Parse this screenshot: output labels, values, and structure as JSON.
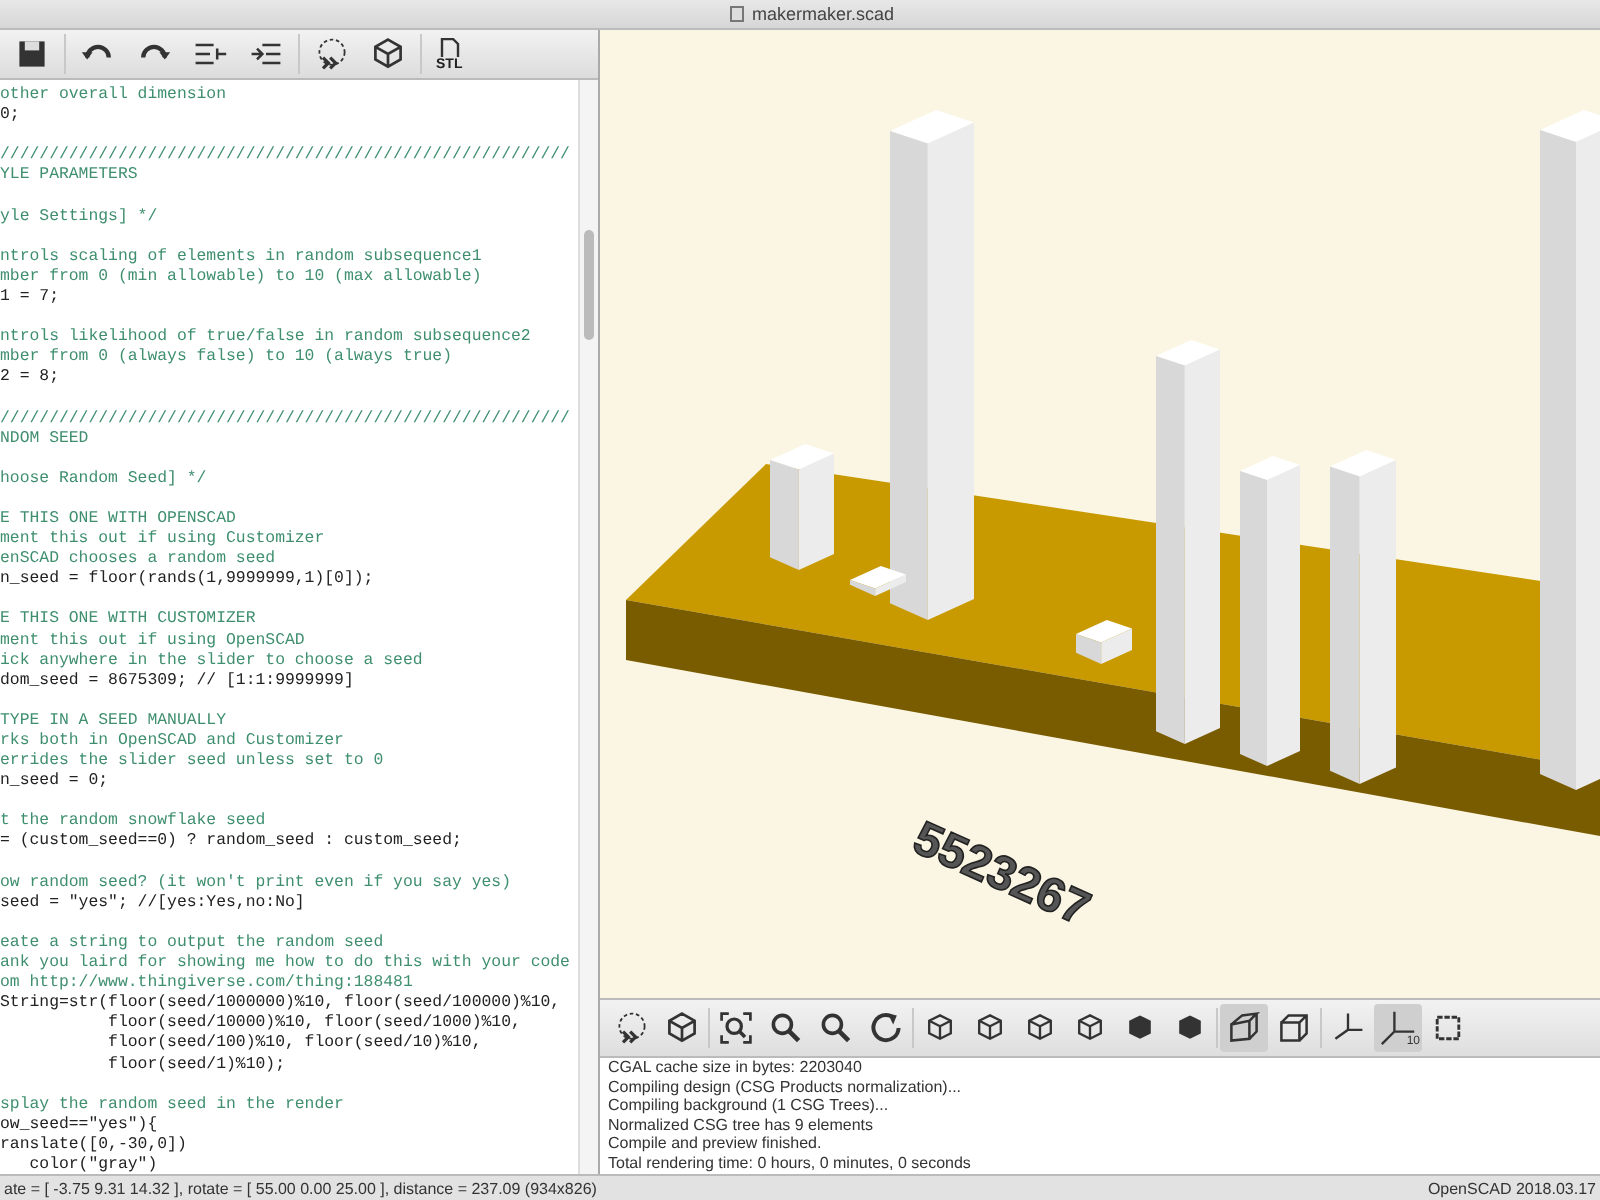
{
  "window": {
    "title": "makermaker.scad"
  },
  "editor_toolbar": [
    {
      "kind": "save"
    },
    {
      "kind": "undo"
    },
    {
      "kind": "redo"
    },
    {
      "kind": "unindent"
    },
    {
      "kind": "indent"
    },
    {
      "kind": "preview"
    },
    {
      "kind": "render"
    },
    {
      "kind": "export",
      "label": "STL"
    }
  ],
  "editor": {
    "lines": [
      {
        "kind": "comment",
        "text": "other overall dimension"
      },
      {
        "kind": "code",
        "text": "0;"
      },
      {
        "kind": "blank"
      },
      {
        "kind": "comment",
        "text": "//////////////////////////////////////////////////////////"
      },
      {
        "kind": "comment",
        "text": "YLE PARAMETERS"
      },
      {
        "kind": "blank"
      },
      {
        "kind": "comment",
        "text": "yle Settings] */"
      },
      {
        "kind": "blank"
      },
      {
        "kind": "comment",
        "text": "ntrols scaling of elements in random subsequence1"
      },
      {
        "kind": "comment",
        "text": "mber from 0 (min allowable) to 10 (max allowable)"
      },
      {
        "kind": "code",
        "text": "1 = 7;"
      },
      {
        "kind": "blank"
      },
      {
        "kind": "comment",
        "text": "ntrols likelihood of true/false in random subsequence2"
      },
      {
        "kind": "comment",
        "text": "mber from 0 (always false) to 10 (always true)"
      },
      {
        "kind": "code",
        "text": "2 = 8;"
      },
      {
        "kind": "blank"
      },
      {
        "kind": "comment",
        "text": "//////////////////////////////////////////////////////////"
      },
      {
        "kind": "comment",
        "text": "NDOM SEED"
      },
      {
        "kind": "blank"
      },
      {
        "kind": "comment",
        "text": "hoose Random Seed] */"
      },
      {
        "kind": "blank"
      },
      {
        "kind": "comment",
        "text": "E THIS ONE WITH OPENSCAD"
      },
      {
        "kind": "comment",
        "text": "ment this out if using Customizer"
      },
      {
        "kind": "comment",
        "text": "enSCAD chooses a random seed"
      },
      {
        "kind": "code",
        "text": "n_seed = floor(rands(1,9999999,1)[0]);"
      },
      {
        "kind": "blank"
      },
      {
        "kind": "comment",
        "text": "E THIS ONE WITH CUSTOMIZER"
      },
      {
        "kind": "comment",
        "text": "ment this out if using OpenSCAD"
      },
      {
        "kind": "comment",
        "text": "ick anywhere in the slider to choose a seed"
      },
      {
        "kind": "code",
        "text": "dom_seed = 8675309; // [1:1:9999999]"
      },
      {
        "kind": "blank"
      },
      {
        "kind": "comment",
        "text": "TYPE IN A SEED MANUALLY"
      },
      {
        "kind": "comment",
        "text": "rks both in OpenSCAD and Customizer"
      },
      {
        "kind": "comment",
        "text": "errides the slider seed unless set to 0"
      },
      {
        "kind": "code",
        "text": "n_seed = 0;"
      },
      {
        "kind": "blank"
      },
      {
        "kind": "comment",
        "text": "t the random snowflake seed"
      },
      {
        "kind": "code",
        "text": "= (custom_seed==0) ? random_seed : custom_seed;"
      },
      {
        "kind": "blank"
      },
      {
        "kind": "comment",
        "text": "ow random seed? (it won't print even if you say yes)"
      },
      {
        "kind": "code",
        "text": "seed = \"yes\"; //[yes:Yes,no:No]"
      },
      {
        "kind": "blank"
      },
      {
        "kind": "comment",
        "text": "eate a string to output the random seed"
      },
      {
        "kind": "comment",
        "text": "ank you laird for showing me how to do this with your code"
      },
      {
        "kind": "comment",
        "text": "om http://www.thingiverse.com/thing:188481"
      },
      {
        "kind": "code",
        "text": "String=str(floor(seed/1000000)%10, floor(seed/100000)%10,"
      },
      {
        "kind": "code",
        "text": "           floor(seed/10000)%10, floor(seed/1000)%10,"
      },
      {
        "kind": "code",
        "text": "           floor(seed/100)%10, floor(seed/10)%10,"
      },
      {
        "kind": "code",
        "text": "           floor(seed/1)%10);"
      },
      {
        "kind": "blank"
      },
      {
        "kind": "comment",
        "text": "splay the random seed in the render"
      },
      {
        "kind": "code",
        "text": "ow_seed==\"yes\"){"
      },
      {
        "kind": "code",
        "text": "ranslate([0,-30,0])"
      },
      {
        "kind": "code",
        "text": "   color(\"gray\")"
      }
    ]
  },
  "viewport": {
    "model_label": "5523267"
  },
  "view_toolbar": [
    {
      "kind": "preview",
      "selected": false
    },
    {
      "kind": "render",
      "selected": false
    },
    {
      "kind": "view-all",
      "selected": false
    },
    {
      "kind": "zoom-in",
      "selected": false
    },
    {
      "kind": "zoom-out",
      "selected": false
    },
    {
      "kind": "reset",
      "selected": false
    },
    {
      "kind": "view-right",
      "selected": false
    },
    {
      "kind": "view-top",
      "selected": false
    },
    {
      "kind": "view-bottom",
      "selected": false
    },
    {
      "kind": "view-left",
      "selected": false
    },
    {
      "kind": "view-front",
      "selected": false
    },
    {
      "kind": "view-back",
      "selected": false
    },
    {
      "kind": "perspective",
      "selected": true
    },
    {
      "kind": "orthogonal",
      "selected": false
    },
    {
      "kind": "axes",
      "selected": false
    },
    {
      "kind": "scale",
      "selected": true,
      "label": "10"
    },
    {
      "kind": "edges",
      "selected": false
    }
  ],
  "console": [
    "CGAL cache size in bytes: 2203040",
    "Compiling design (CSG Products normalization)...",
    "Compiling background (1 CSG Trees)...",
    "Normalized CSG tree has 9 elements",
    "Compile and preview finished.",
    "Total rendering time: 0 hours, 0 minutes, 0 seconds"
  ],
  "status_bar": {
    "left": "ate = [ -3.75 9.31 14.32 ], rotate = [ 55.00 0.00 25.00 ], distance = 237.09 (934x826)",
    "right": "OpenSCAD 2018.03.17"
  }
}
